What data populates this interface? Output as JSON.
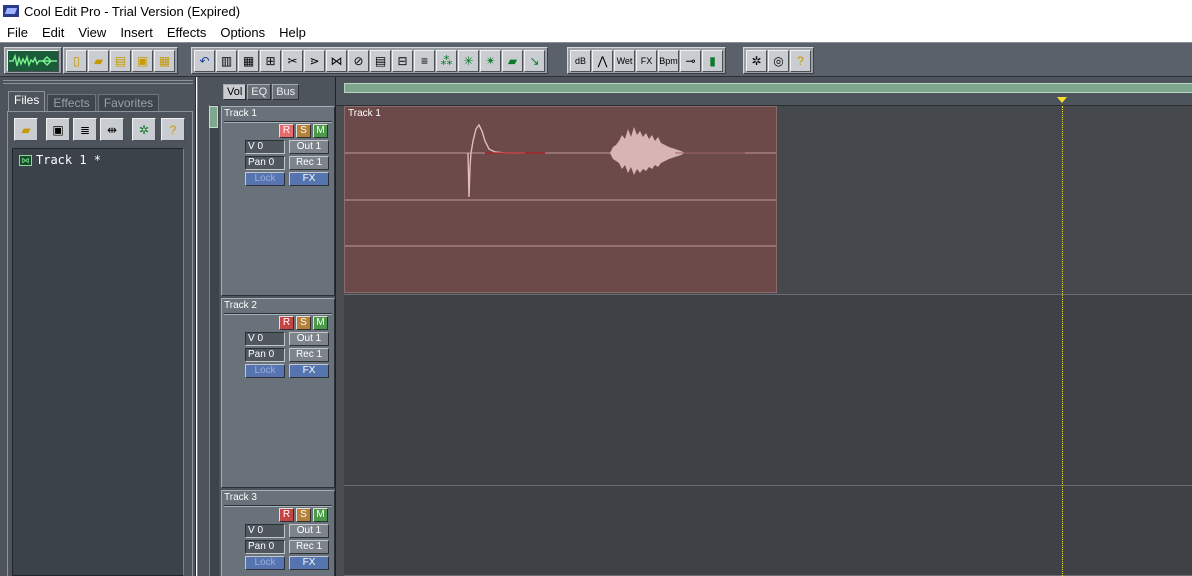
{
  "window": {
    "title": "Cool Edit Pro - Trial Version (Expired)"
  },
  "menu": [
    "File",
    "Edit",
    "View",
    "Insert",
    "Effects",
    "Options",
    "Help"
  ],
  "toolbar": {
    "groups": [
      {
        "buttons": [
          "waveform-mode-icon"
        ]
      },
      {
        "buttons": [
          "new-icon",
          "open-icon",
          "open-append-icon",
          "save-icon",
          "save-all-icon"
        ]
      },
      {
        "buttons": [
          "undo-icon",
          "mix-icon",
          "envelope-icon",
          "insert-icon",
          "cut-icon",
          "split-icon",
          "merge-icon",
          "loop-icon",
          "lock-icon",
          "align-icon",
          "shift-icon",
          "noise-icon",
          "snap-icon",
          "mute-icon",
          "spectral-icon",
          "pan-icon"
        ]
      },
      {
        "buttons": [
          "db-icon",
          "lr-icon",
          "wet-icon",
          "fx-icon",
          "bpm-icon",
          "link-icon",
          "tempo-icon"
        ]
      },
      {
        "buttons": [
          "settings-icon",
          "info-icon",
          "help-icon"
        ]
      }
    ],
    "labels": {
      "db": "dB",
      "wet": "Wet",
      "fx": "FX",
      "bpm": "Bpm",
      "help": "?"
    }
  },
  "organizer": {
    "tabs": [
      "Files",
      "Effects",
      "Favorites"
    ],
    "active_tab": "Files",
    "buttons": [
      "open-file-icon",
      "close-file-icon",
      "insert-into-multitrack-icon",
      "edit-file-icon",
      "organizer-options-icon",
      "help-icon"
    ],
    "help_label": "?",
    "files": [
      {
        "name": "Track 1 *"
      }
    ]
  },
  "view_tabs": [
    "Vol",
    "EQ",
    "Bus"
  ],
  "active_view_tab": "Vol",
  "tracks": [
    {
      "name": "Track 1",
      "r": "R",
      "s": "S",
      "m": "M",
      "volume": "V 0",
      "pan": "Pan 0",
      "out": "Out 1",
      "rec": "Rec 1",
      "lock": "Lock",
      "fx": "FX"
    },
    {
      "name": "Track 2",
      "r": "R",
      "s": "S",
      "m": "M",
      "volume": "V 0",
      "pan": "Pan 0",
      "out": "Out 1",
      "rec": "Rec 1",
      "lock": "Lock",
      "fx": "FX"
    },
    {
      "name": "Track 3",
      "r": "R",
      "s": "S",
      "m": "M",
      "volume": "V 0",
      "pan": "Pan 0",
      "out": "Out 1",
      "rec": "Rec 1",
      "lock": "Lock",
      "fx": "FX"
    }
  ],
  "clips": [
    {
      "label": "Track 1"
    }
  ],
  "colors": {
    "clip": "#6d4a4a",
    "playhead": "#f3de2c",
    "record_active": "#e86a6a",
    "overview": "#7fa68e"
  }
}
